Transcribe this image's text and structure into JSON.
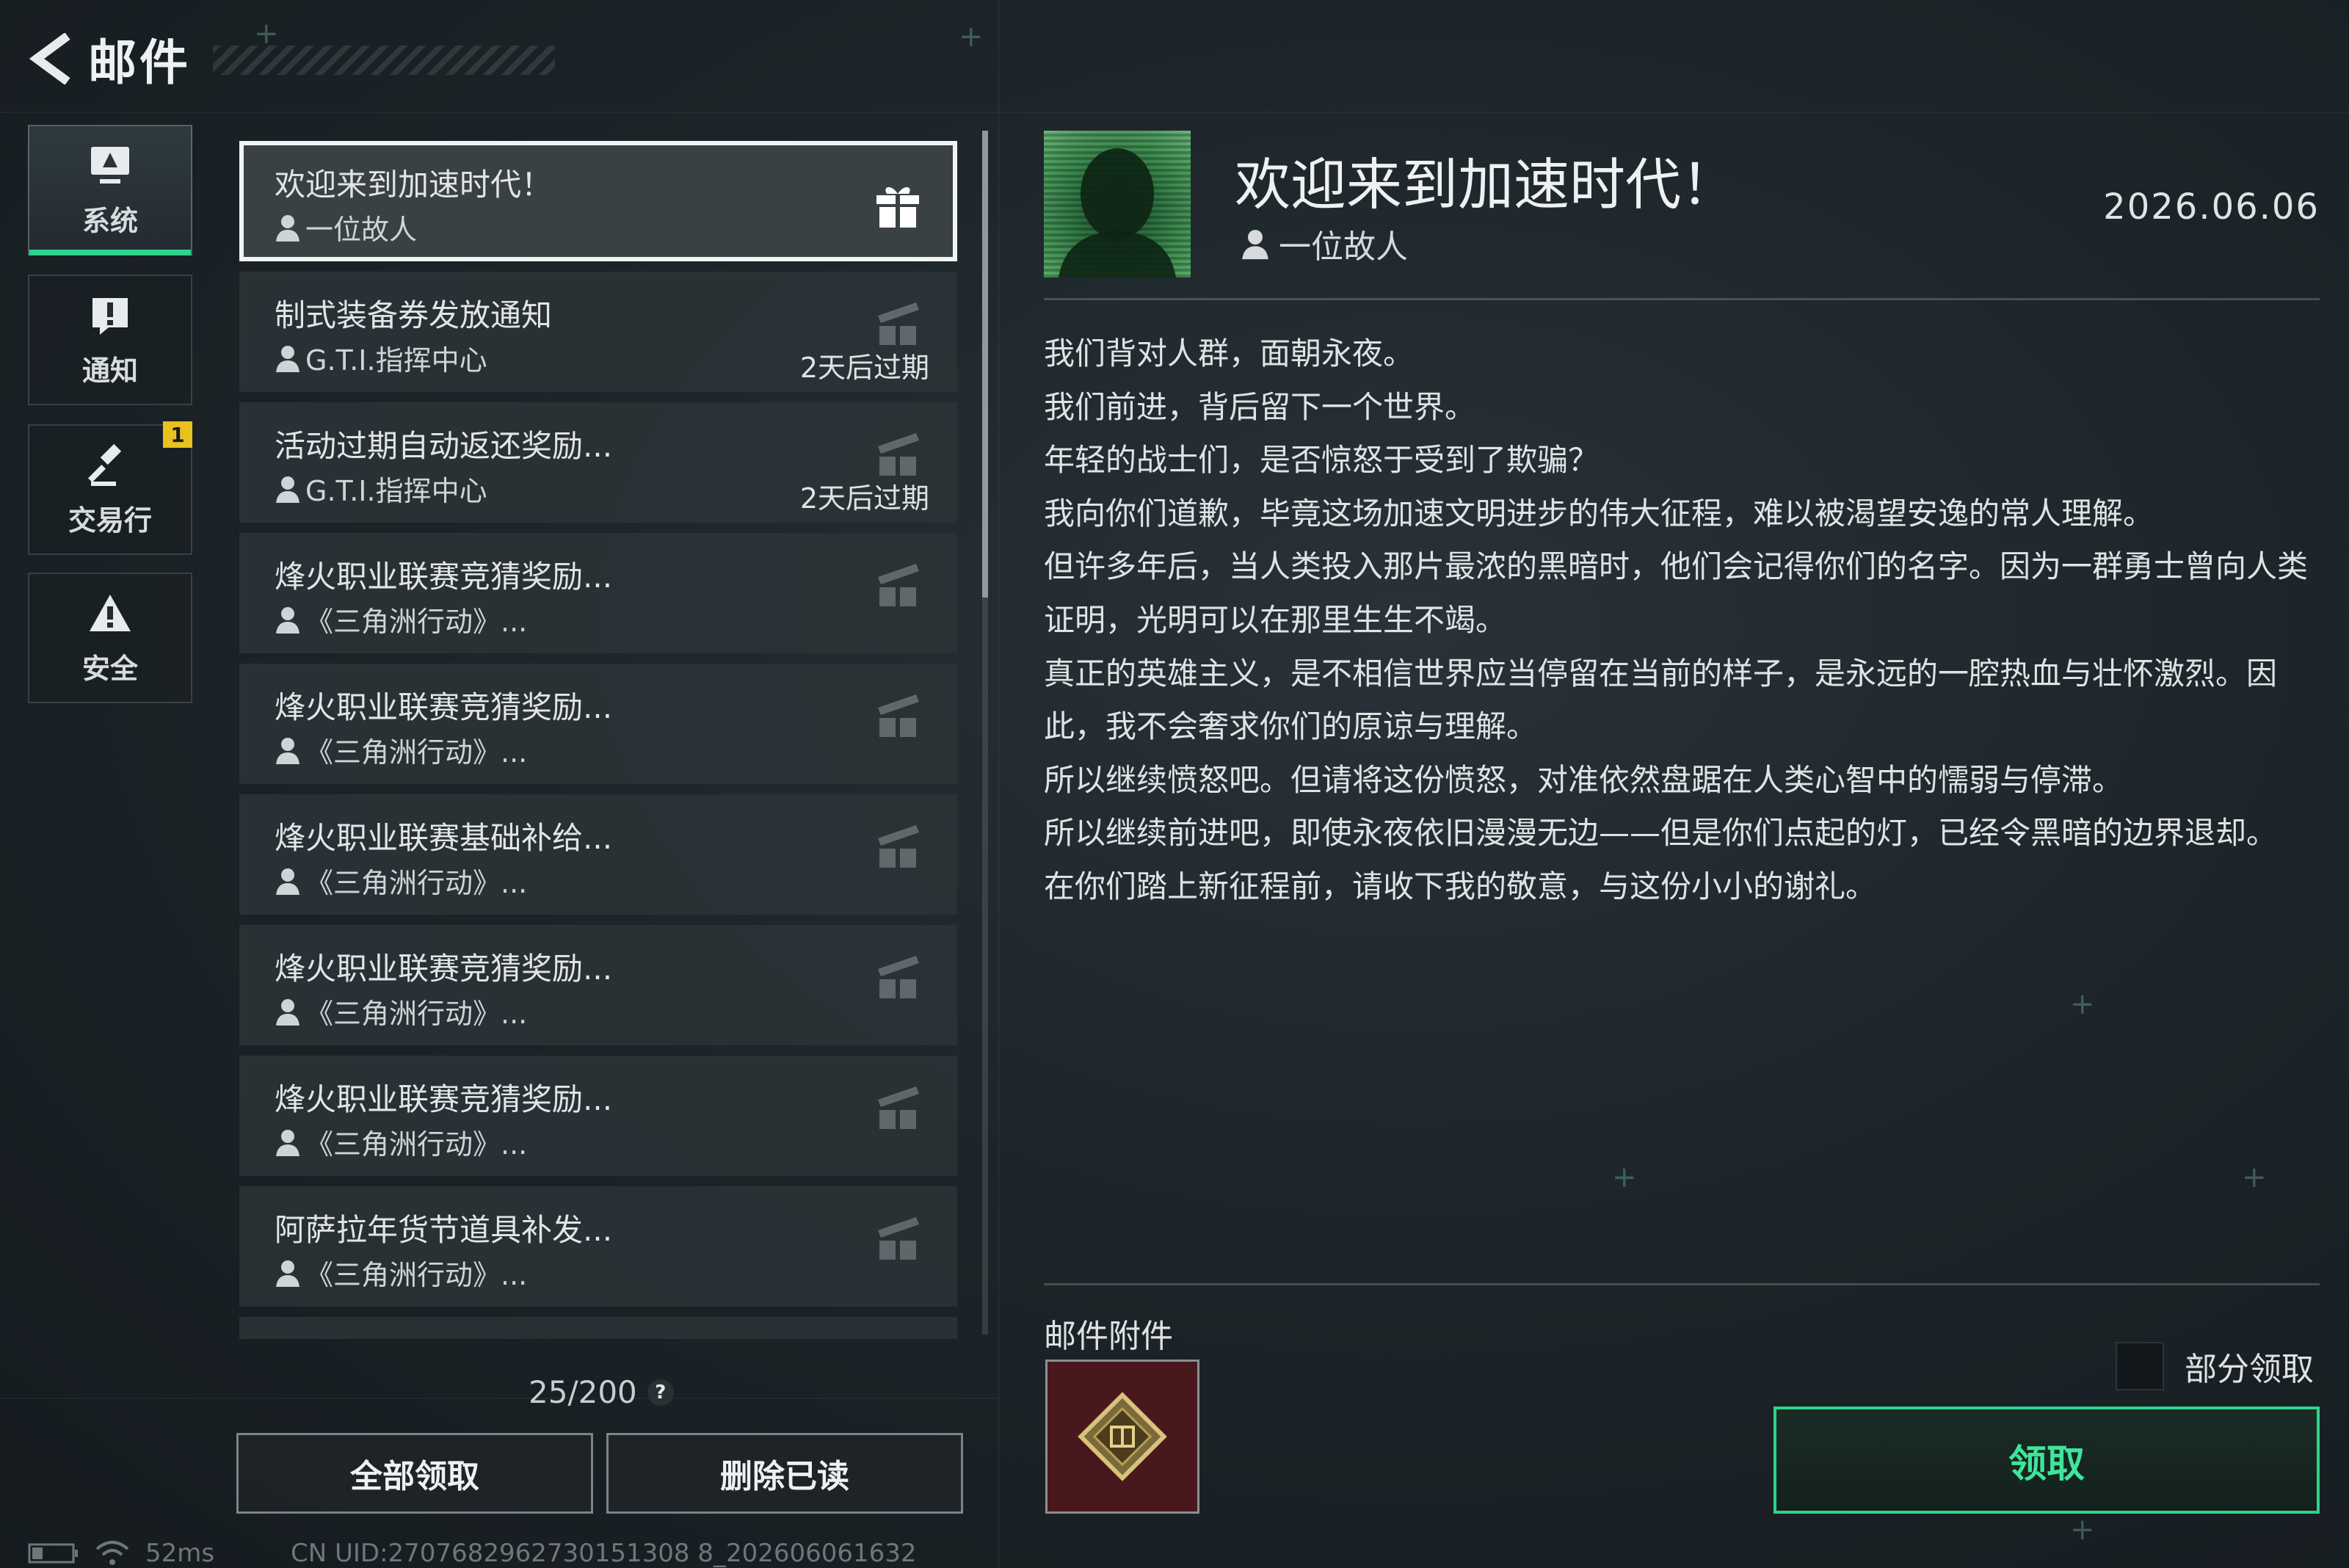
{
  "header": {
    "title": "邮件"
  },
  "nav": {
    "items": [
      {
        "label": "系统",
        "icon": "system-monitor-icon",
        "active": true
      },
      {
        "label": "通知",
        "icon": "exclamation-icon"
      },
      {
        "label": "交易行",
        "icon": "gavel-icon",
        "badge": "1"
      },
      {
        "label": "安全",
        "icon": "warning-triangle-icon"
      }
    ]
  },
  "mail_list": {
    "items": [
      {
        "title": "欢迎来到加速时代！",
        "sender": "一位故人",
        "expire": "",
        "selected": true
      },
      {
        "title": "制式装备券发放通知",
        "sender": "G.T.I.指挥中心",
        "expire": "2天后过期"
      },
      {
        "title": "活动过期自动返还奖励...",
        "sender": "G.T.I.指挥中心",
        "expire": "2天后过期"
      },
      {
        "title": "烽火职业联赛竞猜奖励...",
        "sender": "《三角洲行动》...",
        "expire": ""
      },
      {
        "title": "烽火职业联赛竞猜奖励...",
        "sender": "《三角洲行动》...",
        "expire": ""
      },
      {
        "title": "烽火职业联赛基础补给...",
        "sender": "《三角洲行动》...",
        "expire": ""
      },
      {
        "title": "烽火职业联赛竞猜奖励...",
        "sender": "《三角洲行动》...",
        "expire": ""
      },
      {
        "title": "烽火职业联赛竞猜奖励...",
        "sender": "《三角洲行动》...",
        "expire": ""
      },
      {
        "title": "阿萨拉年货节道具补发...",
        "sender": "《三角洲行动》...",
        "expire": ""
      }
    ],
    "count": "25/200",
    "help": "?",
    "claim_all": "全部领取",
    "delete_read": "删除已读"
  },
  "status_bar": {
    "ping": "52ms",
    "uid": "CN UID:2707682962730151308 8_202606061632"
  },
  "detail": {
    "title": "欢迎来到加速时代！",
    "sender": "一位故人",
    "date": "2026.06.06",
    "body": [
      "我们背对人群，面朝永夜。",
      "我们前进，背后留下一个世界。",
      "年轻的战士们，是否惊怒于受到了欺骗？",
      "我向你们道歉，毕竟这场加速文明进步的伟大征程，难以被渴望安逸的常人理解。",
      "但许多年后，当人类投入那片最浓的黑暗时，他们会记得你们的名字。因为一群勇士曾向人类证明，光明可以在那里生生不竭。",
      "真正的英雄主义，是不相信世界应当停留在当前的样子，是永远的一腔热血与壮怀激烈。因此，我不会奢求你们的原谅与理解。",
      "所以继续愤怒吧。但请将这份愤怒，对准依然盘踞在人类心智中的懦弱与停滞。",
      "所以继续前进吧，即使永夜依旧漫漫无边——但是你们点起的灯，已经令黑暗的边界退却。",
      "在你们踏上新征程前，请收下我的敬意，与这份小小的谢礼。"
    ],
    "attachments_label": "邮件附件",
    "partial_claim": "部分领取",
    "claim": "领取"
  },
  "colors": {
    "accent": "#2fd38a",
    "badge": "#e8c21e",
    "attachment_bg": "#48181c"
  }
}
